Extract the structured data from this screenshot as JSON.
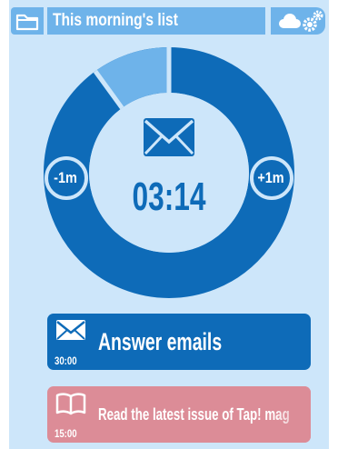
{
  "header": {
    "list_title": "This morning's list",
    "icons": [
      "folder-icon",
      "cloud-icon",
      "gears-icon"
    ]
  },
  "timer": {
    "remaining": "03:14",
    "progress_elapsed": 0.1,
    "decrease_label": "-1m",
    "increase_label": "+1m",
    "icon": "envelope-icon"
  },
  "tasks": [
    {
      "name": "Answer emails",
      "duration": "30:00",
      "icon": "envelope-icon",
      "color": "#0e6bb8"
    },
    {
      "name": "Read the latest issue of Tap! mag",
      "duration": "15:00",
      "icon": "book-icon",
      "color": "#dc8c97"
    }
  ],
  "colors": {
    "background": "#cde6fa",
    "accent": "#0e6bb8",
    "light_accent": "#6eb3ea",
    "next_task": "#dc8c97"
  }
}
